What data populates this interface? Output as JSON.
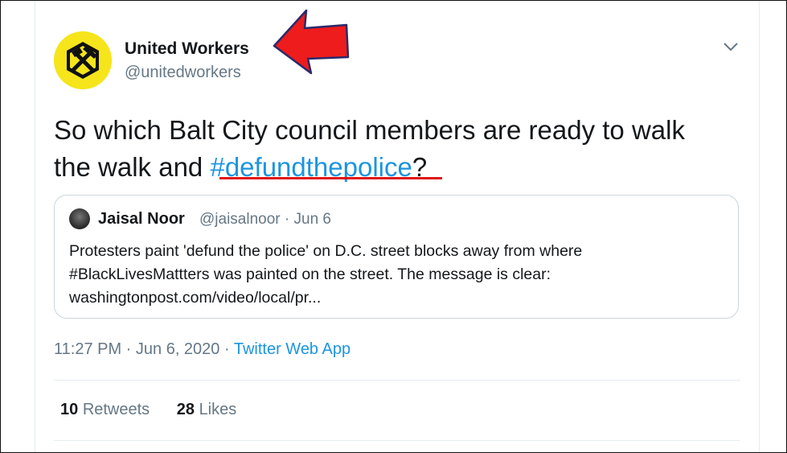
{
  "tweet": {
    "author": {
      "display_name": "United Workers",
      "handle": "@unitedworkers"
    },
    "text_before": "So which Balt City council members are ready to walk the walk and ",
    "hashtag": "#defundthepolice",
    "text_after": "?",
    "timestamp": "11:27 PM · Jun 6, 2020 · ",
    "source_app": "Twitter Web App",
    "stats": {
      "retweets_count": "10",
      "retweets_label": "Retweets",
      "likes_count": "28",
      "likes_label": "Likes"
    }
  },
  "quoted_tweet": {
    "display_name": "Jaisal Noor",
    "handle_date": "@jaisalnoor · Jun 6",
    "line1": "Protesters paint 'defund the police' on D.C. street blocks away from where",
    "line2": "#BlackLivesMattters was painted on the street. The message is clear:",
    "line3": "washingtonpost.com/video/local/pr..."
  },
  "colors": {
    "link_blue": "#1b95e0",
    "annotation_red": "#e01414",
    "avatar_yellow": "#f5e51a"
  },
  "icons": [
    "chevron-down-icon",
    "hammer-pick-logo",
    "annotation-arrow"
  ]
}
